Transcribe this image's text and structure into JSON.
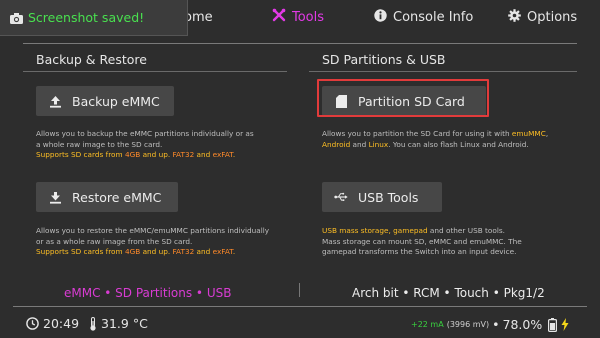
{
  "toast": {
    "text": "Screenshot saved!",
    "icon": "camera-icon"
  },
  "nav": {
    "home_partial": "ome",
    "tools": "Tools",
    "console_info": "Console Info",
    "options": "Options",
    "active_color": "#e23ae6"
  },
  "left": {
    "title": "Backup & Restore",
    "backup": {
      "label": "Backup eMMC",
      "desc1": "Allows you to backup the eMMC partitions individually or as",
      "desc2": "a whole raw image to the SD card.",
      "desc3_a": "Supports SD cards from ",
      "desc3_b": "4GB",
      "desc3_c": " and up. ",
      "desc3_d": "FAT32",
      "desc3_e": " and ",
      "desc3_f": "exFAT",
      "desc3_g": "."
    },
    "restore": {
      "label": "Restore eMMC",
      "desc1": "Allows you to restore the eMMC/emuMMC partitions individually",
      "desc2": "or as a whole raw image from the SD card.",
      "desc3_a": "Supports SD cards from ",
      "desc3_b": "4GB",
      "desc3_c": " and up. ",
      "desc3_d": "FAT32",
      "desc3_e": " and ",
      "desc3_f": "exFAT",
      "desc3_g": "."
    }
  },
  "right": {
    "title": "SD Partitions & USB",
    "partition": {
      "label": "Partition SD Card",
      "desc1_a": "Allows you to partition the SD Card for using it with ",
      "desc1_b": "emuMMC",
      "desc1_c": ",",
      "desc2_a": "Android",
      "desc2_b": " and ",
      "desc2_c": "Linux",
      "desc2_d": ". You can also flash Linux and Android."
    },
    "usb": {
      "label": "USB Tools",
      "desc1_a": "USB mass storage, gamepad",
      "desc1_b": " and other USB tools.",
      "desc2": "Mass storage can mount SD, eMMC and emuMMC. The",
      "desc3": "gamepad transforms the Switch into an input device."
    }
  },
  "footer": {
    "left": "eMMC • SD Partitions • USB",
    "right": "Arch bit • RCM • Touch • Pkg1/2",
    "accent": "#d93cd3"
  },
  "status": {
    "time": "20:49",
    "temp": "31.9 °C",
    "current": "+22 mA",
    "voltage": "(3996 mV)",
    "battery_pct": "78.0%",
    "charging_color": "#f5d81a"
  }
}
